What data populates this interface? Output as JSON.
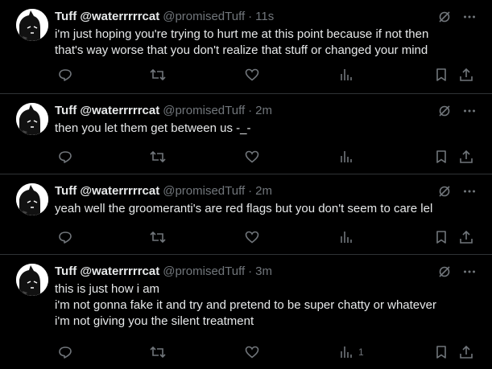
{
  "colors": {
    "background": "#000000",
    "text": "#e7e9ea",
    "muted": "#71767b",
    "divider": "#2f3336"
  },
  "icons": [
    "grok-icon",
    "more-icon",
    "reply-icon",
    "retweet-icon",
    "like-icon",
    "views-icon",
    "bookmark-icon",
    "share-icon"
  ],
  "tweets": [
    {
      "display_name": "Tuff @waterrrrrcat",
      "handle": "@promisedTuff",
      "separator": "·",
      "time": "11s",
      "lines": [
        "i'm just hoping you're trying to hurt me at this point because if not then",
        "that's way worse that you don't realize that stuff or changed your mind"
      ],
      "views": ""
    },
    {
      "display_name": "Tuff @waterrrrrcat",
      "handle": "@promisedTuff",
      "separator": "·",
      "time": "2m",
      "lines": [
        "then you let them get between us -_-"
      ],
      "views": ""
    },
    {
      "display_name": "Tuff @waterrrrrcat",
      "handle": "@promisedTuff",
      "separator": "·",
      "time": "2m",
      "lines": [
        "yeah well the groomeranti's are red flags but you don't seem to care lel"
      ],
      "views": ""
    },
    {
      "display_name": "Tuff @waterrrrrcat",
      "handle": "@promisedTuff",
      "separator": "·",
      "time": "3m",
      "lines": [
        "this is just how i am",
        "i'm not gonna fake it and try and pretend to be super chatty or whatever",
        "i'm not giving you the silent treatment"
      ],
      "views": "1"
    }
  ]
}
